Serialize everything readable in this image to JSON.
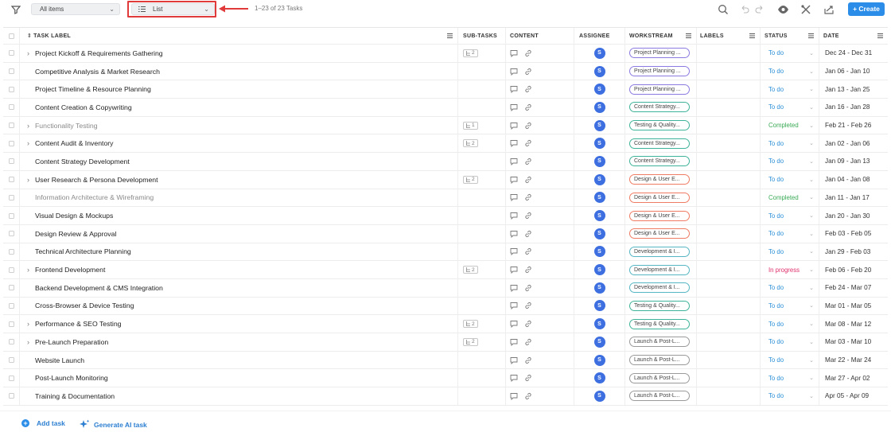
{
  "toolbar": {
    "scope_select": "All items",
    "view_select": "List",
    "task_count": "1–23 of 23 Tasks",
    "create_label": "+ Create"
  },
  "columns": {
    "task_label": "TASK LABEL",
    "sub_tasks": "SUB-TASKS",
    "content": "CONTENT",
    "assignee": "ASSIGNEE",
    "workstream": "WORKSTREAM",
    "labels": "LABELS",
    "status": "STATUS",
    "date": "DATE"
  },
  "colors": {
    "accent": "#2c8de8",
    "highlight": "#e03a3a",
    "ws_planning": "#8b7be0",
    "ws_content": "#3fb39a",
    "ws_testing": "#3fb39a",
    "ws_design": "#ef7b62",
    "ws_dev": "#56b6c4",
    "ws_launch": "#9a9a9a",
    "status_todo": "#2a8fd8",
    "status_completed": "#3aaa55",
    "status_inprogress": "#e0306b"
  },
  "tasks": [
    {
      "label": "Project Kickoff & Requirements Gathering",
      "expandable": true,
      "done": false,
      "subtasks": "2",
      "assignee": "S",
      "workstream": "Project Planning ...",
      "ws_color": "#8b7be0",
      "status": "To do",
      "status_color": "#2a8fd8",
      "date": "Dec 24 - Dec 31"
    },
    {
      "label": "Competitive Analysis & Market Research",
      "expandable": false,
      "done": false,
      "subtasks": "",
      "assignee": "S",
      "workstream": "Project Planning ...",
      "ws_color": "#8b7be0",
      "status": "To do",
      "status_color": "#2a8fd8",
      "date": "Jan 06 - Jan 10"
    },
    {
      "label": "Project Timeline & Resource Planning",
      "expandable": false,
      "done": false,
      "subtasks": "",
      "assignee": "S",
      "workstream": "Project Planning ...",
      "ws_color": "#8b7be0",
      "status": "To do",
      "status_color": "#2a8fd8",
      "date": "Jan 13 - Jan 25"
    },
    {
      "label": "Content Creation & Copywriting",
      "expandable": false,
      "done": false,
      "subtasks": "",
      "assignee": "S",
      "workstream": "Content Strategy...",
      "ws_color": "#3fb39a",
      "status": "To do",
      "status_color": "#2a8fd8",
      "date": "Jan 16 - Jan 28"
    },
    {
      "label": "Functionality Testing",
      "expandable": true,
      "done": true,
      "subtasks": "1",
      "assignee": "S",
      "workstream": "Testing & Quality...",
      "ws_color": "#3fb39a",
      "status": "Completed",
      "status_color": "#3aaa55",
      "date": "Feb 21 - Feb 26"
    },
    {
      "label": "Content Audit & Inventory",
      "expandable": true,
      "done": false,
      "subtasks": "2",
      "assignee": "S",
      "workstream": "Content Strategy...",
      "ws_color": "#3fb39a",
      "status": "To do",
      "status_color": "#2a8fd8",
      "date": "Jan 02 - Jan 06"
    },
    {
      "label": "Content Strategy Development",
      "expandable": false,
      "done": false,
      "subtasks": "",
      "assignee": "S",
      "workstream": "Content Strategy...",
      "ws_color": "#3fb39a",
      "status": "To do",
      "status_color": "#2a8fd8",
      "date": "Jan 09 - Jan 13"
    },
    {
      "label": "User Research & Persona Development",
      "expandable": true,
      "done": false,
      "subtasks": "2",
      "assignee": "S",
      "workstream": "Design & User E...",
      "ws_color": "#ef7b62",
      "status": "To do",
      "status_color": "#2a8fd8",
      "date": "Jan 04 - Jan 08"
    },
    {
      "label": "Information Architecture & Wireframing",
      "expandable": false,
      "done": true,
      "subtasks": "",
      "assignee": "S",
      "workstream": "Design & User E...",
      "ws_color": "#ef7b62",
      "status": "Completed",
      "status_color": "#3aaa55",
      "date": "Jan 11 - Jan 17"
    },
    {
      "label": "Visual Design & Mockups",
      "expandable": false,
      "done": false,
      "subtasks": "",
      "assignee": "S",
      "workstream": "Design & User E...",
      "ws_color": "#ef7b62",
      "status": "To do",
      "status_color": "#2a8fd8",
      "date": "Jan 20 - Jan 30"
    },
    {
      "label": "Design Review & Approval",
      "expandable": false,
      "done": false,
      "subtasks": "",
      "assignee": "S",
      "workstream": "Design & User E...",
      "ws_color": "#ef7b62",
      "status": "To do",
      "status_color": "#2a8fd8",
      "date": "Feb 03 - Feb 05"
    },
    {
      "label": "Technical Architecture Planning",
      "expandable": false,
      "done": false,
      "subtasks": "",
      "assignee": "S",
      "workstream": "Development & I...",
      "ws_color": "#56b6c4",
      "status": "To do",
      "status_color": "#2a8fd8",
      "date": "Jan 29 - Feb 03"
    },
    {
      "label": "Frontend Development",
      "expandable": true,
      "done": false,
      "subtasks": "2",
      "assignee": "S",
      "workstream": "Development & I...",
      "ws_color": "#56b6c4",
      "status": "In progress",
      "status_color": "#e0306b",
      "date": "Feb 06 - Feb 20"
    },
    {
      "label": "Backend Development & CMS Integration",
      "expandable": false,
      "done": false,
      "subtasks": "",
      "assignee": "S",
      "workstream": "Development & I...",
      "ws_color": "#56b6c4",
      "status": "To do",
      "status_color": "#2a8fd8",
      "date": "Feb 24 - Mar 07"
    },
    {
      "label": "Cross-Browser & Device Testing",
      "expandable": false,
      "done": false,
      "subtasks": "",
      "assignee": "S",
      "workstream": "Testing & Quality...",
      "ws_color": "#3fb39a",
      "status": "To do",
      "status_color": "#2a8fd8",
      "date": "Mar 01 - Mar 05"
    },
    {
      "label": "Performance & SEO Testing",
      "expandable": true,
      "done": false,
      "subtasks": "2",
      "assignee": "S",
      "workstream": "Testing & Quality...",
      "ws_color": "#3fb39a",
      "status": "To do",
      "status_color": "#2a8fd8",
      "date": "Mar 08 - Mar 12"
    },
    {
      "label": "Pre-Launch Preparation",
      "expandable": true,
      "done": false,
      "subtasks": "2",
      "assignee": "S",
      "workstream": "Launch & Post-L...",
      "ws_color": "#9a9a9a",
      "status": "To do",
      "status_color": "#2a8fd8",
      "date": "Mar 03 - Mar 10"
    },
    {
      "label": "Website Launch",
      "expandable": false,
      "done": false,
      "subtasks": "",
      "assignee": "S",
      "workstream": "Launch & Post-L...",
      "ws_color": "#9a9a9a",
      "status": "To do",
      "status_color": "#2a8fd8",
      "date": "Mar 22 - Mar 24"
    },
    {
      "label": "Post-Launch Monitoring",
      "expandable": false,
      "done": false,
      "subtasks": "",
      "assignee": "S",
      "workstream": "Launch & Post-L...",
      "ws_color": "#9a9a9a",
      "status": "To do",
      "status_color": "#2a8fd8",
      "date": "Mar 27 - Apr 02"
    },
    {
      "label": "Training & Documentation",
      "expandable": false,
      "done": false,
      "subtasks": "",
      "assignee": "S",
      "workstream": "Launch & Post-L...",
      "ws_color": "#9a9a9a",
      "status": "To do",
      "status_color": "#2a8fd8",
      "date": "Apr 05 - Apr 09"
    }
  ],
  "footer": {
    "add_task": "Add task",
    "generate_ai": "Generate AI task"
  }
}
